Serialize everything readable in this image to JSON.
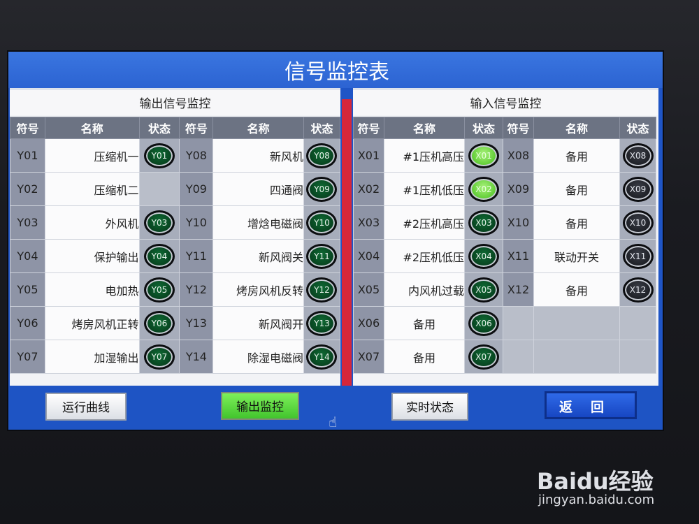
{
  "title": "信号监控表",
  "left_panel": {
    "title": "输出信号监控",
    "headers": [
      "符号",
      "名称",
      "状态",
      "符号",
      "名称",
      "状态"
    ],
    "rows": [
      {
        "sym1": "Y01",
        "name1": "压缩机一",
        "led1": "Y01",
        "sym2": "Y08",
        "name2": "新风机",
        "led2": "Y08"
      },
      {
        "sym1": "Y02",
        "name1": "压缩机二",
        "led1": "",
        "sym2": "Y09",
        "name2": "四通阀",
        "led2": "Y09"
      },
      {
        "sym1": "Y03",
        "name1": "外风机",
        "led1": "Y03",
        "sym2": "Y10",
        "name2": "增焓电磁阀",
        "led2": "Y10"
      },
      {
        "sym1": "Y04",
        "name1": "保护输出",
        "led1": "Y04",
        "sym2": "Y11",
        "name2": "新风阀关",
        "led2": "Y11"
      },
      {
        "sym1": "Y05",
        "name1": "电加热",
        "led1": "Y05",
        "sym2": "Y12",
        "name2": "烤房风机反转",
        "led2": "Y12"
      },
      {
        "sym1": "Y06",
        "name1": "烤房风机正转",
        "led1": "Y06",
        "sym2": "Y13",
        "name2": "新风阀开",
        "led2": "Y13"
      },
      {
        "sym1": "Y07",
        "name1": "加湿输出",
        "led1": "Y07",
        "sym2": "Y14",
        "name2": "除湿电磁阀",
        "led2": "Y14"
      }
    ]
  },
  "right_panel": {
    "title": "输入信号监控",
    "headers": [
      "符号",
      "名称",
      "状态",
      "符号",
      "名称",
      "状态"
    ],
    "rows": [
      {
        "sym1": "X01",
        "name1": "#1压机高压",
        "led1": "X01",
        "sym2": "X08",
        "name2": "备用",
        "led2": "X08"
      },
      {
        "sym1": "X02",
        "name1": "#1压机低压",
        "led1": "X02",
        "sym2": "X09",
        "name2": "备用",
        "led2": "X09"
      },
      {
        "sym1": "X03",
        "name1": "#2压机高压",
        "led1": "X03",
        "sym2": "X10",
        "name2": "备用",
        "led2": "X10"
      },
      {
        "sym1": "X04",
        "name1": "#2压机低压",
        "led1": "X04",
        "sym2": "X11",
        "name2": "联动开关",
        "led2": "X11"
      },
      {
        "sym1": "X05",
        "name1": "内风机过载",
        "led1": "X05",
        "sym2": "X12",
        "name2": "备用",
        "led2": "X12"
      },
      {
        "sym1": "X06",
        "name1": "备用",
        "led1": "X06",
        "sym2": "",
        "name2": "",
        "led2": ""
      },
      {
        "sym1": "X07",
        "name1": "备用",
        "led1": "X07",
        "sym2": "",
        "name2": "",
        "led2": ""
      }
    ]
  },
  "buttons": {
    "curve": "运行曲线",
    "output": "输出监控",
    "realtime": "实时状态",
    "back": "返回"
  },
  "watermark": {
    "logo": "Baidu经验",
    "url": "jingyan.baidu.com"
  },
  "colors": {
    "screen_bg": "#1f55c6",
    "led_off": "#0f6a34",
    "led_on": "#59c92e",
    "divider": "#d6273a",
    "active_button": "#42c42d"
  }
}
